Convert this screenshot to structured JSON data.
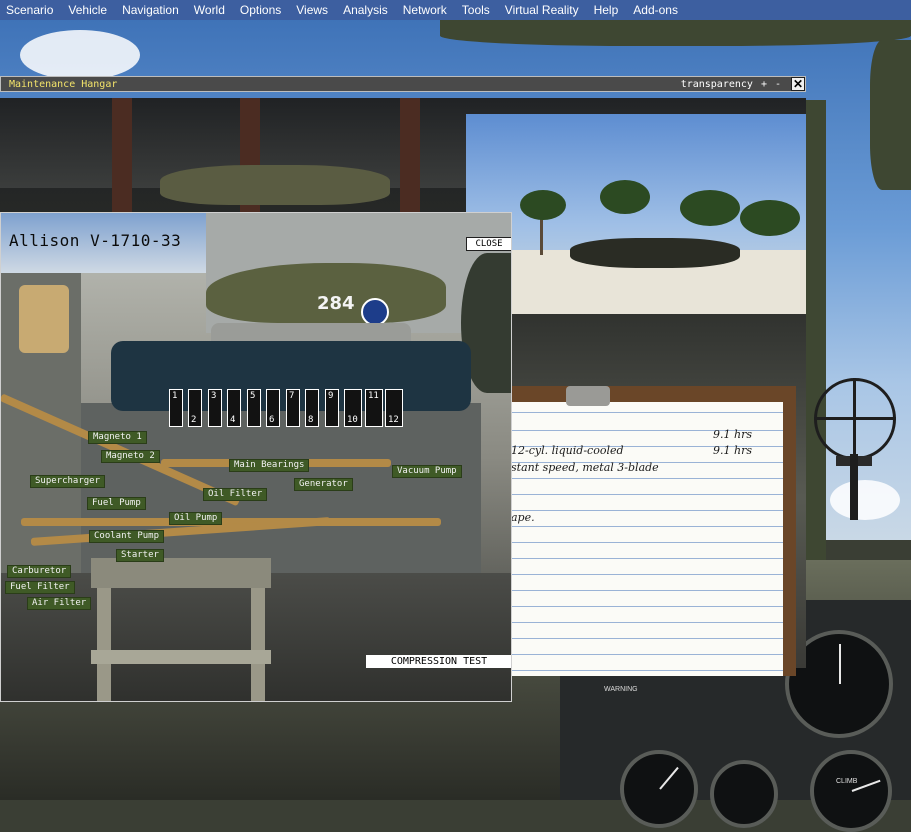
{
  "menubar": {
    "items": [
      "Scenario",
      "Vehicle",
      "Navigation",
      "World",
      "Options",
      "Views",
      "Analysis",
      "Network",
      "Tools",
      "Virtual Reality",
      "Help",
      "Add-ons"
    ]
  },
  "hangar_window": {
    "title": "Maintenance Hangar",
    "transparency_label": "transparency",
    "plus": "+",
    "minus": "-",
    "close_glyph": "✕"
  },
  "log_card": {
    "lines": [
      {
        "text": "12-cyl. liquid-cooled",
        "hrs": "9.1 hrs"
      },
      {
        "text": "stant speed, metal 3-blade",
        "hrs": ""
      },
      {
        "text": "ape.",
        "hrs": ""
      }
    ],
    "first_hrs": "9.1 hrs"
  },
  "engine_panel": {
    "title": "Allison V-1710-33",
    "close_label": "CLOSE",
    "compression_test_label": "COMPRESSION TEST",
    "aircraft_marking": "284",
    "cylinders": [
      "1",
      "2",
      "3",
      "4",
      "5",
      "6",
      "7",
      "8",
      "9",
      "10",
      "11",
      "12"
    ],
    "components": {
      "magneto1": "Magneto 1",
      "magneto2": "Magneto 2",
      "main_bearings": "Main Bearings",
      "vacuum_pump": "Vacuum Pump",
      "supercharger": "Supercharger",
      "generator": "Generator",
      "oil_filter": "Oil Filter",
      "fuel_pump": "Fuel Pump",
      "oil_pump": "Oil Pump",
      "coolant_pump": "Coolant Pump",
      "starter": "Starter",
      "carburetor": "Carburetor",
      "fuel_filter": "Fuel Filter",
      "air_filter": "Air Filter"
    }
  },
  "instrument_panel": {
    "warning_label": "WARNING",
    "climb_label": "CLIMB"
  },
  "colors": {
    "menubar_bg": "#3d5fa0",
    "component_label_bg": "#3f5a26",
    "title_text": "#f3e36a"
  }
}
